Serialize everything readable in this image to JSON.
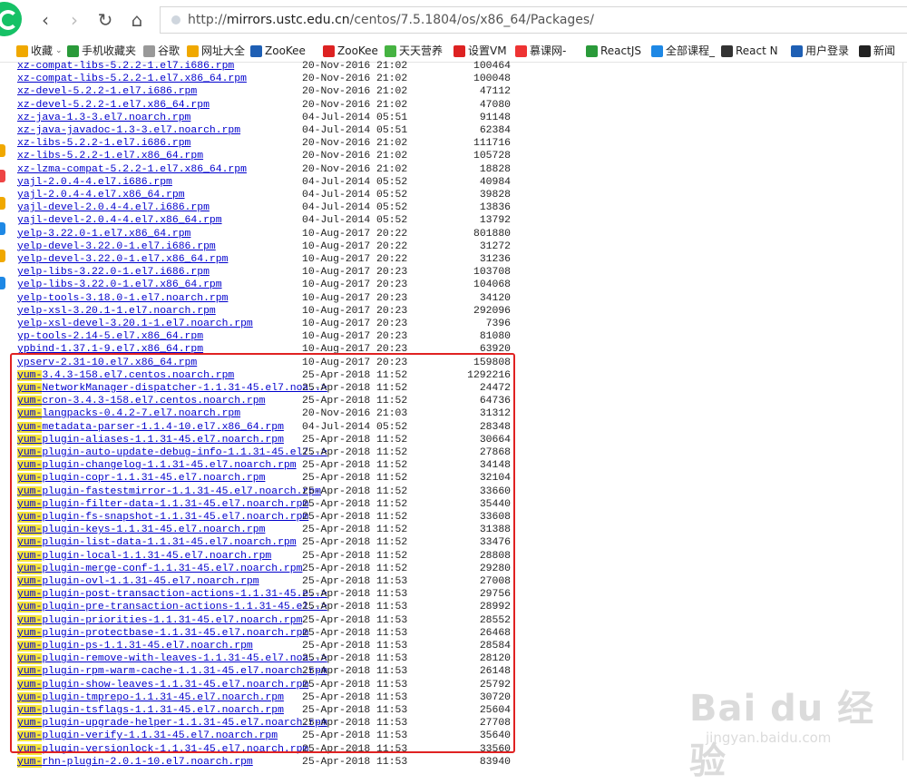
{
  "browser": {
    "url_prefix": "http://",
    "url_host": "mirrors.ustc.edu.cn",
    "url_path": "/centos/7.5.1804/os/x86_64/Packages/"
  },
  "bookmarks": [
    {
      "label": "收藏",
      "icon": "star-icon",
      "color": "#f0a800",
      "dropdown": true
    },
    {
      "label": "手机收藏夹",
      "icon": "mobile-icon",
      "color": "#2a9a3a"
    },
    {
      "label": "谷歌",
      "icon": "page-icon",
      "color": "#999999"
    },
    {
      "label": "网址大全",
      "icon": "sites-icon",
      "color": "#f0a800"
    },
    {
      "label": "ZooKee",
      "icon": "zookee-icon",
      "color": "#1e5fb4"
    },
    {
      "label": "ZooKee",
      "icon": "zookee-icon",
      "color": "#d22"
    },
    {
      "label": "天天营养",
      "icon": "nutrition-icon",
      "color": "#46b342"
    },
    {
      "label": "设置VM",
      "icon": "csdn-icon",
      "color": "#d22"
    },
    {
      "label": "慕课网-",
      "icon": "fire-icon",
      "color": "#e33"
    },
    {
      "label": "ReactJS",
      "icon": "react-green-icon",
      "color": "#2a9a3a"
    },
    {
      "label": "全部课程_",
      "icon": "shield-icon",
      "color": "#1e88e5"
    },
    {
      "label": "React N",
      "icon": "react-icon",
      "color": "#333333"
    },
    {
      "label": "用户登录",
      "icon": "zt-icon",
      "color": "#1e5fb4"
    },
    {
      "label": "新闻",
      "icon": "news-icon",
      "color": "#222222"
    }
  ],
  "files": [
    {
      "name": "xz-compat-libs-5.2.2-1.el7.i686.rpm",
      "date": "20-Nov-2016 21:02",
      "size": "100464",
      "hl": ""
    },
    {
      "name": "xz-compat-libs-5.2.2-1.el7.x86_64.rpm",
      "date": "20-Nov-2016 21:02",
      "size": "100048",
      "hl": ""
    },
    {
      "name": "xz-devel-5.2.2-1.el7.i686.rpm",
      "date": "20-Nov-2016 21:02",
      "size": "47112",
      "hl": ""
    },
    {
      "name": "xz-devel-5.2.2-1.el7.x86_64.rpm",
      "date": "20-Nov-2016 21:02",
      "size": "47080",
      "hl": ""
    },
    {
      "name": "xz-java-1.3-3.el7.noarch.rpm",
      "date": "04-Jul-2014 05:51",
      "size": "91148",
      "hl": ""
    },
    {
      "name": "xz-java-javadoc-1.3-3.el7.noarch.rpm",
      "date": "04-Jul-2014 05:51",
      "size": "62384",
      "hl": ""
    },
    {
      "name": "xz-libs-5.2.2-1.el7.i686.rpm",
      "date": "20-Nov-2016 21:02",
      "size": "111716",
      "hl": ""
    },
    {
      "name": "xz-libs-5.2.2-1.el7.x86_64.rpm",
      "date": "20-Nov-2016 21:02",
      "size": "105728",
      "hl": ""
    },
    {
      "name": "xz-lzma-compat-5.2.2-1.el7.x86_64.rpm",
      "date": "20-Nov-2016 21:02",
      "size": "18828",
      "hl": ""
    },
    {
      "name": "yajl-2.0.4-4.el7.i686.rpm",
      "date": "04-Jul-2014 05:52",
      "size": "40984",
      "hl": ""
    },
    {
      "name": "yajl-2.0.4-4.el7.x86_64.rpm",
      "date": "04-Jul-2014 05:52",
      "size": "39828",
      "hl": ""
    },
    {
      "name": "yajl-devel-2.0.4-4.el7.i686.rpm",
      "date": "04-Jul-2014 05:52",
      "size": "13836",
      "hl": ""
    },
    {
      "name": "yajl-devel-2.0.4-4.el7.x86_64.rpm",
      "date": "04-Jul-2014 05:52",
      "size": "13792",
      "hl": ""
    },
    {
      "name": "yelp-3.22.0-1.el7.x86_64.rpm",
      "date": "10-Aug-2017 20:22",
      "size": "801880",
      "hl": ""
    },
    {
      "name": "yelp-devel-3.22.0-1.el7.i686.rpm",
      "date": "10-Aug-2017 20:22",
      "size": "31272",
      "hl": ""
    },
    {
      "name": "yelp-devel-3.22.0-1.el7.x86_64.rpm",
      "date": "10-Aug-2017 20:22",
      "size": "31236",
      "hl": ""
    },
    {
      "name": "yelp-libs-3.22.0-1.el7.i686.rpm",
      "date": "10-Aug-2017 20:23",
      "size": "103708",
      "hl": ""
    },
    {
      "name": "yelp-libs-3.22.0-1.el7.x86_64.rpm",
      "date": "10-Aug-2017 20:23",
      "size": "104068",
      "hl": ""
    },
    {
      "name": "yelp-tools-3.18.0-1.el7.noarch.rpm",
      "date": "10-Aug-2017 20:23",
      "size": "34120",
      "hl": ""
    },
    {
      "name": "yelp-xsl-3.20.1-1.el7.noarch.rpm",
      "date": "10-Aug-2017 20:23",
      "size": "292096",
      "hl": ""
    },
    {
      "name": "yelp-xsl-devel-3.20.1-1.el7.noarch.rpm",
      "date": "10-Aug-2017 20:23",
      "size": "7396",
      "hl": ""
    },
    {
      "name": "yp-tools-2.14-5.el7.x86_64.rpm",
      "date": "10-Aug-2017 20:23",
      "size": "81080",
      "hl": ""
    },
    {
      "name": "ypbind-1.37.1-9.el7.x86_64.rpm",
      "date": "10-Aug-2017 20:23",
      "size": "63920",
      "hl": ""
    },
    {
      "name": "ypserv-2.31-10.el7.x86_64.rpm",
      "date": "10-Aug-2017 20:23",
      "size": "159808",
      "hl": ""
    },
    {
      "name": "3.4.3-158.el7.centos.noarch.rpm",
      "date": "25-Apr-2018 11:52",
      "size": "1292216",
      "hl": "yum-"
    },
    {
      "name": "NetworkManager-dispatcher-1.1.31-45.el7.noa..>",
      "date": "25-Apr-2018 11:52",
      "size": "24472",
      "hl": "yum-"
    },
    {
      "name": "cron-3.4.3-158.el7.centos.noarch.rpm",
      "date": "25-Apr-2018 11:52",
      "size": "64736",
      "hl": "yum-"
    },
    {
      "name": "langpacks-0.4.2-7.el7.noarch.rpm",
      "date": "20-Nov-2016 21:03",
      "size": "31312",
      "hl": "yum-"
    },
    {
      "name": "metadata-parser-1.1.4-10.el7.x86_64.rpm",
      "date": "04-Jul-2014 05:52",
      "size": "28348",
      "hl": "yum-"
    },
    {
      "name": "plugin-aliases-1.1.31-45.el7.noarch.rpm",
      "date": "25-Apr-2018 11:52",
      "size": "30664",
      "hl": "yum-"
    },
    {
      "name": "plugin-auto-update-debug-info-1.1.31-45.el7..>",
      "date": "25-Apr-2018 11:52",
      "size": "27868",
      "hl": "yum-"
    },
    {
      "name": "plugin-changelog-1.1.31-45.el7.noarch.rpm",
      "date": "25-Apr-2018 11:52",
      "size": "34148",
      "hl": "yum-"
    },
    {
      "name": "plugin-copr-1.1.31-45.el7.noarch.rpm",
      "date": "25-Apr-2018 11:52",
      "size": "32104",
      "hl": "yum-"
    },
    {
      "name": "plugin-fastestmirror-1.1.31-45.el7.noarch.rpm",
      "date": "25-Apr-2018 11:52",
      "size": "33660",
      "hl": "yum-"
    },
    {
      "name": "plugin-filter-data-1.1.31-45.el7.noarch.rpm",
      "date": "25-Apr-2018 11:52",
      "size": "35440",
      "hl": "yum-"
    },
    {
      "name": "plugin-fs-snapshot-1.1.31-45.el7.noarch.rpm",
      "date": "25-Apr-2018 11:52",
      "size": "33608",
      "hl": "yum-"
    },
    {
      "name": "plugin-keys-1.1.31-45.el7.noarch.rpm",
      "date": "25-Apr-2018 11:52",
      "size": "31388",
      "hl": "yum-"
    },
    {
      "name": "plugin-list-data-1.1.31-45.el7.noarch.rpm",
      "date": "25-Apr-2018 11:52",
      "size": "33476",
      "hl": "yum-"
    },
    {
      "name": "plugin-local-1.1.31-45.el7.noarch.rpm",
      "date": "25-Apr-2018 11:52",
      "size": "28808",
      "hl": "yum-"
    },
    {
      "name": "plugin-merge-conf-1.1.31-45.el7.noarch.rpm",
      "date": "25-Apr-2018 11:52",
      "size": "29280",
      "hl": "yum-"
    },
    {
      "name": "plugin-ovl-1.1.31-45.el7.noarch.rpm",
      "date": "25-Apr-2018 11:53",
      "size": "27008",
      "hl": "yum-"
    },
    {
      "name": "plugin-post-transaction-actions-1.1.31-45.e..>",
      "date": "25-Apr-2018 11:53",
      "size": "29756",
      "hl": "yum-"
    },
    {
      "name": "plugin-pre-transaction-actions-1.1.31-45.el..>",
      "date": "25-Apr-2018 11:53",
      "size": "28992",
      "hl": "yum-"
    },
    {
      "name": "plugin-priorities-1.1.31-45.el7.noarch.rpm",
      "date": "25-Apr-2018 11:53",
      "size": "28552",
      "hl": "yum-"
    },
    {
      "name": "plugin-protectbase-1.1.31-45.el7.noarch.rpm",
      "date": "25-Apr-2018 11:53",
      "size": "26468",
      "hl": "yum-"
    },
    {
      "name": "plugin-ps-1.1.31-45.el7.noarch.rpm",
      "date": "25-Apr-2018 11:53",
      "size": "28584",
      "hl": "yum-"
    },
    {
      "name": "plugin-remove-with-leaves-1.1.31-45.el7.noa..>",
      "date": "25-Apr-2018 11:53",
      "size": "28120",
      "hl": "yum-"
    },
    {
      "name": "plugin-rpm-warm-cache-1.1.31-45.el7.noarch.rpm",
      "date": "25-Apr-2018 11:53",
      "size": "26148",
      "hl": "yum-"
    },
    {
      "name": "plugin-show-leaves-1.1.31-45.el7.noarch.rpm",
      "date": "25-Apr-2018 11:53",
      "size": "25792",
      "hl": "yum-"
    },
    {
      "name": "plugin-tmprepo-1.1.31-45.el7.noarch.rpm",
      "date": "25-Apr-2018 11:53",
      "size": "30720",
      "hl": "yum-"
    },
    {
      "name": "plugin-tsflags-1.1.31-45.el7.noarch.rpm",
      "date": "25-Apr-2018 11:53",
      "size": "25604",
      "hl": "yum-"
    },
    {
      "name": "plugin-upgrade-helper-1.1.31-45.el7.noarch.rpm",
      "date": "25-Apr-2018 11:53",
      "size": "27708",
      "hl": "yum-"
    },
    {
      "name": "plugin-verify-1.1.31-45.el7.noarch.rpm",
      "date": "25-Apr-2018 11:53",
      "size": "35640",
      "hl": "yum-"
    },
    {
      "name": "plugin-versionlock-1.1.31-45.el7.noarch.rpm",
      "date": "25-Apr-2018 11:53",
      "size": "33560",
      "hl": "yum-"
    },
    {
      "name": "rhn-plugin-2.0.1-10.el7.noarch.rpm",
      "date": "25-Apr-2018 11:53",
      "size": "83940",
      "hl": "yum-"
    }
  ],
  "watermark": {
    "logo": "Bai du 经验",
    "sub": "jingyan.baidu.com"
  },
  "colors": {
    "link": "#0000cc",
    "highlight": "#f5e33b",
    "annotation_box": "#e02222"
  }
}
